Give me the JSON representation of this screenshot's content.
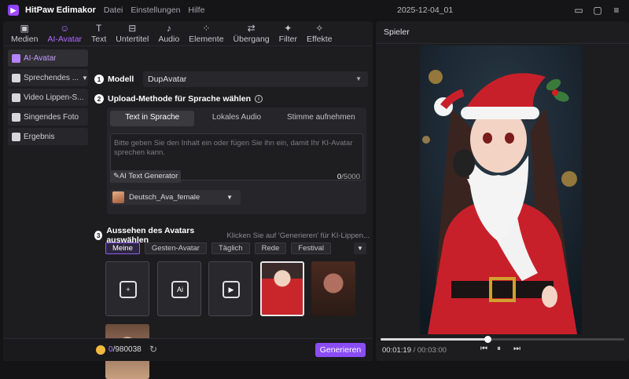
{
  "app": {
    "name": "HitPaw Edimakor",
    "menu": [
      "Datei",
      "Einstellungen",
      "Hilfe"
    ],
    "project_date": "2025-12-04_01"
  },
  "toolbar": [
    {
      "label": "Medien",
      "icon": "media-icon"
    },
    {
      "label": "AI-Avatar",
      "icon": "ai-avatar-icon",
      "active": true
    },
    {
      "label": "Text",
      "icon": "text-icon"
    },
    {
      "label": "Untertitel",
      "icon": "subtitle-icon"
    },
    {
      "label": "Audio",
      "icon": "audio-icon"
    },
    {
      "label": "Elemente",
      "icon": "elements-icon"
    },
    {
      "label": "Übergang",
      "icon": "transition-icon"
    },
    {
      "label": "Filter",
      "icon": "filter-icon"
    },
    {
      "label": "Effekte",
      "icon": "effects-icon"
    }
  ],
  "sidebar": [
    {
      "label": "AI-Avatar"
    },
    {
      "label": "Sprechendes ..."
    },
    {
      "label": "Video Lippen-S..."
    },
    {
      "label": "Singendes Foto"
    },
    {
      "label": "Ergebnis"
    }
  ],
  "step1": {
    "num": "1",
    "title": "Modell",
    "model": "DupAvatar"
  },
  "step2": {
    "num": "2",
    "title": "Upload-Methode für Sprache wählen",
    "tabs": [
      "Text in Sprache",
      "Lokales Audio",
      "Stimme aufnehmen"
    ],
    "placeholder": "Bitte geben Sie den Inhalt ein oder fügen Sie ihn ein, damit Ihr KI-Avatar sprechen kann.",
    "generator_label": "AI Text Generator",
    "count_current": "0",
    "count_max": "/5000",
    "voice": "Deutsch_Ava_female"
  },
  "step3": {
    "num": "3",
    "title": "Aussehen des Avatars auswählen",
    "hint": "Klicken Sie auf 'Generieren' für KI-Lippen...",
    "filters": [
      "Meine",
      "Gesten-Avatar",
      "Täglich",
      "Rede",
      "Festival"
    ]
  },
  "bottom": {
    "credits_used": "0",
    "credits_total": "/980038",
    "generate_label": "Generieren"
  },
  "player": {
    "title": "Spieler",
    "current_time": "00:01:19",
    "total_time": "/ 00:03:00",
    "progress": 0.44
  }
}
